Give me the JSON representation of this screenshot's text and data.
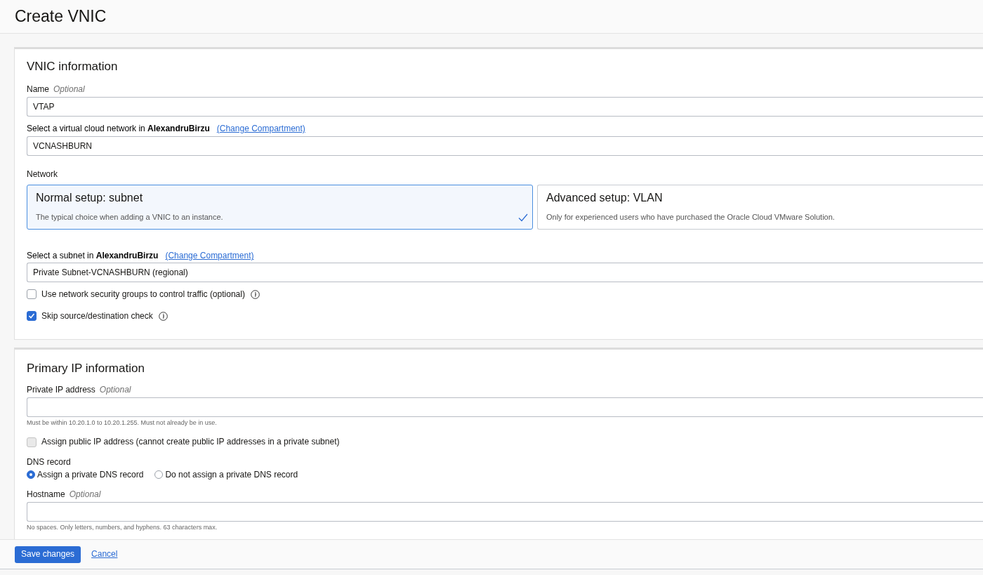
{
  "page": {
    "title": "Create VNIC"
  },
  "vnic_information": {
    "title": "VNIC information",
    "name_field": {
      "label": "Name",
      "hint": "Optional",
      "value": "VTAP"
    },
    "vcn_field": {
      "label": "Select a virtual cloud network in **AlexandruBirzu**",
      "link": "(Change Compartment)",
      "value": "VCNASHBURN"
    },
    "network": {
      "label": "Network",
      "options": [
        {
          "title": "Normal setup: subnet",
          "description": "The typical choice when adding a VNIC to an instance.",
          "selected": true
        },
        {
          "title": "Advanced setup: VLAN",
          "description": "Only for experienced users who have purchased the Oracle Cloud VMware Solution.",
          "selected": false
        }
      ]
    },
    "subnet_field": {
      "label": "Select a subnet in **AlexandruBirzu**",
      "link": "(Change Compartment)",
      "value": "Private Subnet-VCNASHBURN (regional)"
    },
    "checkboxes": [
      {
        "label": "Use network security groups to control traffic (optional)",
        "checked": false,
        "disabled": false,
        "info": true
      },
      {
        "label": "Skip source/destination check",
        "checked": true,
        "disabled": false,
        "info": true
      }
    ]
  },
  "primary_ip_information": {
    "title": "Primary IP information",
    "private_ip_field": {
      "label": "Private IP address",
      "hint": "Optional",
      "help": "Must be within 10.20.1.0 to 10.20.1.255. Must not already be in use."
    },
    "public_ip_checkbox": {
      "label": "Assign public IP address (cannot create public IP addresses in a private subnet)",
      "checked": false,
      "disabled": true
    },
    "dns_record": {
      "label": "DNS record",
      "options": [
        {
          "label": "Assign a private DNS record",
          "selected": true
        },
        {
          "label": "Do not assign a private DNS record",
          "selected": false
        }
      ]
    },
    "hostname_field": {
      "label": "Hostname",
      "hint": "Optional",
      "help": "No spaces. Only letters, numbers, and hyphens. 63 characters max."
    }
  },
  "footer": {
    "primary_button": "Save changes",
    "cancel_link": "Cancel"
  }
}
